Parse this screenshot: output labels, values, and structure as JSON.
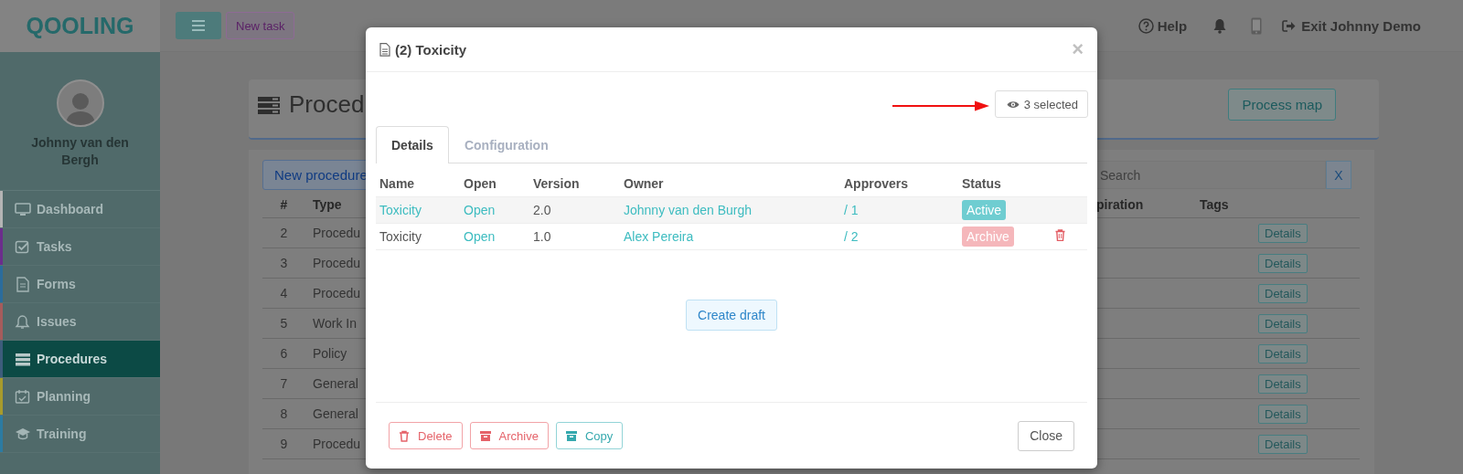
{
  "brand": {
    "logo": "QOOLING"
  },
  "topbar": {
    "new_task": "New task",
    "help": "Help",
    "exit": "Exit Johnny Demo"
  },
  "sidebar": {
    "user_name": "Johnny van den Bergh",
    "items": [
      {
        "label": "Dashboard",
        "color": "#b4b4b4",
        "selected": false
      },
      {
        "label": "Tasks",
        "color": "#6b2d8c",
        "selected": false
      },
      {
        "label": "Forms",
        "color": "#2b6c9c",
        "selected": false
      },
      {
        "label": "Issues",
        "color": "#a65c5c",
        "selected": false
      },
      {
        "label": "Procedures",
        "color": "#3d5c7c",
        "selected": true
      },
      {
        "label": "Planning",
        "color": "#a89b2c",
        "selected": false
      },
      {
        "label": "Training",
        "color": "#2c7ba2",
        "selected": false
      }
    ]
  },
  "page": {
    "title": "Proced",
    "process_map": "Process map",
    "new_procedure": "New procedure",
    "search": {
      "placeholder": "Search"
    },
    "clear": "X",
    "columns": [
      "#",
      "Type",
      "piration",
      "Tags"
    ],
    "rows": [
      {
        "number": "2",
        "type": "Procedu",
        "action": "Details"
      },
      {
        "number": "3",
        "type": "Procedu",
        "action": "Details"
      },
      {
        "number": "4",
        "type": "Procedu",
        "action": "Details"
      },
      {
        "number": "5",
        "type": "Work In",
        "action": "Details"
      },
      {
        "number": "6",
        "type": "Policy",
        "action": "Details"
      },
      {
        "number": "7",
        "type": "General",
        "action": "Details"
      },
      {
        "number": "8",
        "type": "General",
        "action": "Details"
      },
      {
        "number": "9",
        "type": "Procedu",
        "action": "Details"
      }
    ]
  },
  "modal": {
    "title": "(2) Toxicity",
    "dismiss": "×",
    "selected_filter": "3 selected",
    "tabs": [
      {
        "label": "Details",
        "selected": true
      },
      {
        "label": "Configuration",
        "selected": false
      }
    ],
    "columns": [
      "Name",
      "Open",
      "Version",
      "Owner",
      "Approvers",
      "Status"
    ],
    "rows": [
      {
        "name": "Toxicity",
        "name_link": true,
        "open": "Open",
        "version": "2.0",
        "owner": "Johnny van den Burgh",
        "approvers": "/ 1",
        "status": "Active",
        "color": "#6fcdd1",
        "deletable": false
      },
      {
        "name": "Toxicity",
        "name_link": false,
        "open": "Open",
        "version": "1.0",
        "owner": "Alex Pereira",
        "approvers": "/ 2",
        "status": "Archive",
        "color": "#f5b7bb",
        "deletable": true
      }
    ],
    "create_draft": "Create draft",
    "actions": [
      {
        "label": "Delete",
        "kind": "danger"
      },
      {
        "label": "Archive",
        "kind": "danger"
      },
      {
        "label": "Copy",
        "kind": "info"
      }
    ],
    "close": "Close"
  }
}
